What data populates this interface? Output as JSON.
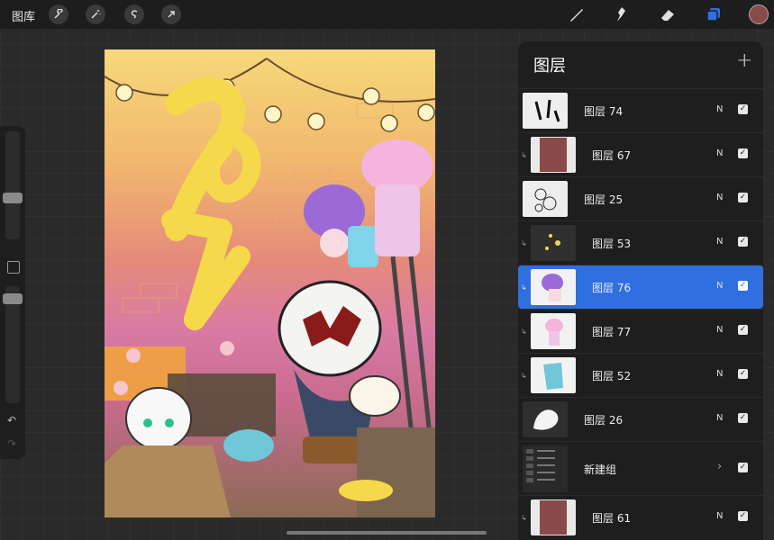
{
  "topbar": {
    "gallery_label": "图库",
    "left_tools": [
      "wrench-icon",
      "magic-wand-icon",
      "selection-icon",
      "transform-arrow-icon"
    ],
    "right_tools": [
      "brush-icon",
      "smudge-icon",
      "eraser-icon",
      "layers-icon"
    ],
    "active_color": "#8a4a4a",
    "accent": "#2f6fe0"
  },
  "sidebar": {
    "undo_icon": "↶",
    "redo_icon": "↷"
  },
  "layers_panel": {
    "title": "图层",
    "add_icon": "+",
    "layers": [
      {
        "name": "图层 74",
        "blend": "N",
        "visible_mark": "✓"
      },
      {
        "name": "图层 67",
        "blend": "N",
        "visible_mark": "✓"
      },
      {
        "name": "图层 25",
        "blend": "N",
        "visible_mark": "✓"
      },
      {
        "name": "图层 53",
        "blend": "N",
        "visible_mark": "✓"
      },
      {
        "name": "图层 76",
        "blend": "N",
        "visible_mark": "✓"
      },
      {
        "name": "图层 77",
        "blend": "N",
        "visible_mark": "✓"
      },
      {
        "name": "图层 52",
        "blend": "N",
        "visible_mark": "✓"
      },
      {
        "name": "图层 26",
        "blend": "N",
        "visible_mark": "✓"
      },
      {
        "name": "新建组",
        "blend": "›",
        "visible_mark": "✓"
      },
      {
        "name": "图层 61",
        "blend": "N",
        "visible_mark": "✓"
      }
    ]
  }
}
